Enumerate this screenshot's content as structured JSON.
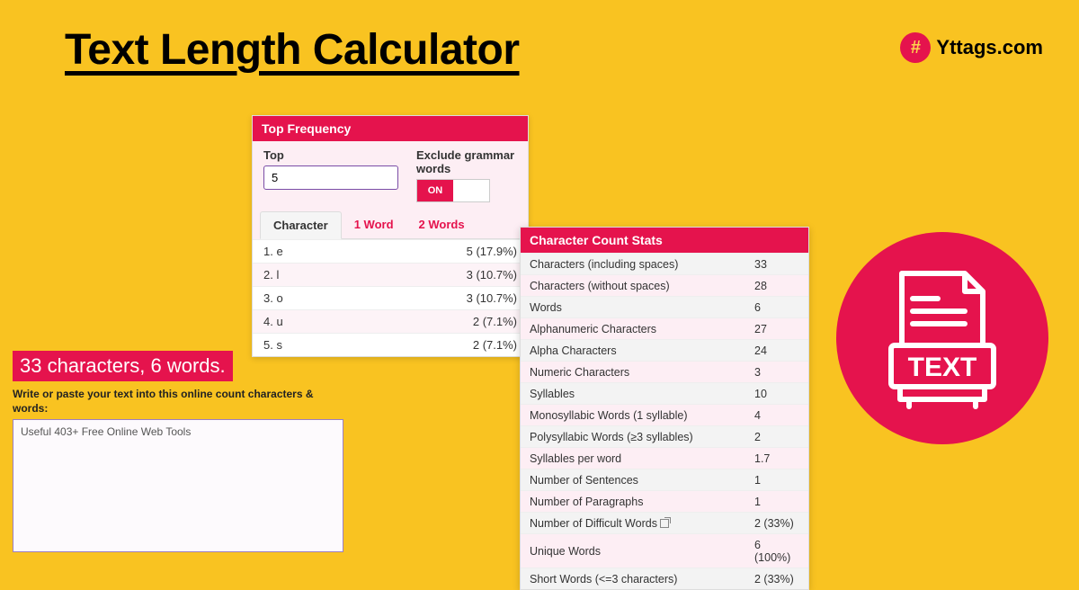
{
  "title": " Text Length Calculator ",
  "brand": {
    "name": "Yttags.com",
    "icon_glyph": "#"
  },
  "top_frequency": {
    "header": "Top Frequency",
    "top_label": "Top",
    "top_value": "5",
    "exclude_label": "Exclude grammar words",
    "toggle_on": "ON",
    "tabs": [
      "Character",
      "1 Word",
      "2 Words"
    ],
    "rows": [
      {
        "rank": "1. e",
        "val": "5 (17.9%)"
      },
      {
        "rank": "2. l",
        "val": "3 (10.7%)"
      },
      {
        "rank": "3. o",
        "val": "3 (10.7%)"
      },
      {
        "rank": "4. u",
        "val": "2 (7.1%)"
      },
      {
        "rank": "5. s",
        "val": "2 (7.1%)"
      }
    ]
  },
  "counter": {
    "banner": "33 characters, 6 words.",
    "instruction": "Write or paste your text into this online count characters & words:",
    "textarea_value": "Useful 403+ Free Online Web Tools"
  },
  "stats": {
    "header": "Character Count Stats",
    "rows": [
      {
        "label": "Characters (including spaces)",
        "val": "33"
      },
      {
        "label": "Characters (without spaces)",
        "val": "28"
      },
      {
        "label": "Words",
        "val": "6"
      },
      {
        "label": "Alphanumeric Characters",
        "val": "27"
      },
      {
        "label": "Alpha Characters",
        "val": "24"
      },
      {
        "label": "Numeric Characters",
        "val": "3"
      },
      {
        "label": "Syllables",
        "val": "10"
      },
      {
        "label": "Monosyllabic Words (1 syllable)",
        "val": "4"
      },
      {
        "label": "Polysyllabic Words (≥3 syllables)",
        "val": "2"
      },
      {
        "label": "Syllables per word",
        "val": "1.7"
      },
      {
        "label": "Number of Sentences",
        "val": "1"
      },
      {
        "label": "Number of Paragraphs",
        "val": "1"
      },
      {
        "label": "Number of Difficult Words",
        "val": "2 (33%)",
        "ext": true
      },
      {
        "label": "Unique Words",
        "val": "6 (100%)"
      },
      {
        "label": "Short Words (<=3 characters)",
        "val": "2 (33%)"
      }
    ]
  },
  "badge": {
    "text": "TEXT"
  }
}
